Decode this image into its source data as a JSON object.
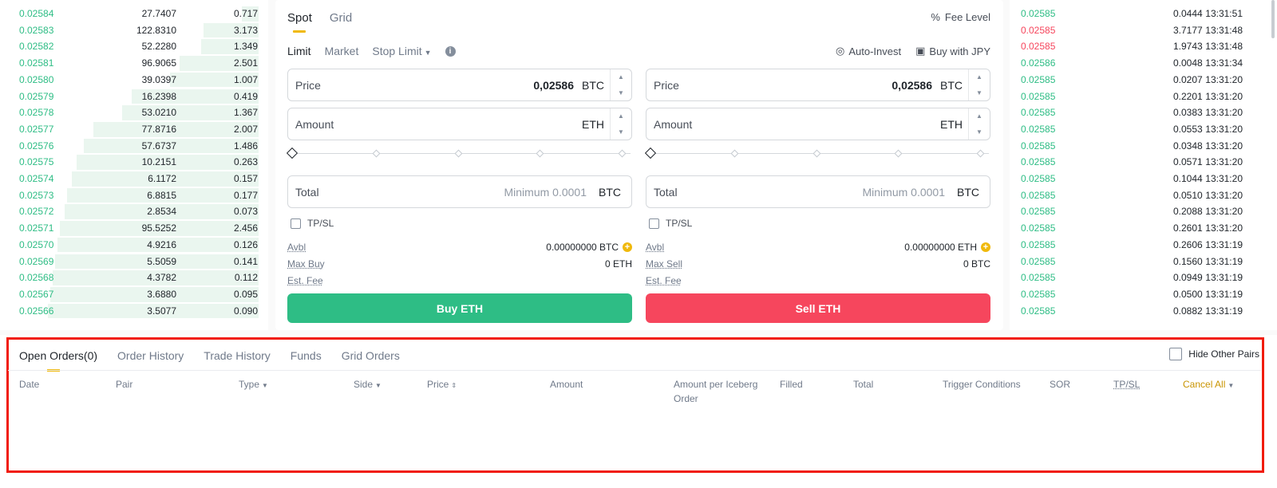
{
  "orderbook": {
    "rows": [
      {
        "price": "0.02584",
        "amount": "27.7407",
        "total": "0.717",
        "depth": 0.07
      },
      {
        "price": "0.02583",
        "amount": "122.8310",
        "total": "3.173",
        "depth": 0.23
      },
      {
        "price": "0.02582",
        "amount": "52.2280",
        "total": "1.349",
        "depth": 0.24
      },
      {
        "price": "0.02581",
        "amount": "96.9065",
        "total": "2.501",
        "depth": 0.33
      },
      {
        "price": "0.02580",
        "amount": "39.0397",
        "total": "1.007",
        "depth": 0.37
      },
      {
        "price": "0.02579",
        "amount": "16.2398",
        "total": "0.419",
        "depth": 0.53
      },
      {
        "price": "0.02578",
        "amount": "53.0210",
        "total": "1.367",
        "depth": 0.57
      },
      {
        "price": "0.02577",
        "amount": "77.8716",
        "total": "2.007",
        "depth": 0.69
      },
      {
        "price": "0.02576",
        "amount": "57.6737",
        "total": "1.486",
        "depth": 0.73
      },
      {
        "price": "0.02575",
        "amount": "10.2151",
        "total": "0.263",
        "depth": 0.76
      },
      {
        "price": "0.02574",
        "amount": "6.1172",
        "total": "0.157",
        "depth": 0.78
      },
      {
        "price": "0.02573",
        "amount": "6.8815",
        "total": "0.177",
        "depth": 0.8
      },
      {
        "price": "0.02572",
        "amount": "2.8534",
        "total": "0.073",
        "depth": 0.81
      },
      {
        "price": "0.02571",
        "amount": "95.5252",
        "total": "2.456",
        "depth": 0.83
      },
      {
        "price": "0.02570",
        "amount": "4.9216",
        "total": "0.126",
        "depth": 0.84
      },
      {
        "price": "0.02569",
        "amount": "5.5059",
        "total": "0.141",
        "depth": 0.85
      },
      {
        "price": "0.02568",
        "amount": "4.3782",
        "total": "0.112",
        "depth": 0.86
      },
      {
        "price": "0.02567",
        "amount": "3.6880",
        "total": "0.095",
        "depth": 0.87
      },
      {
        "price": "0.02566",
        "amount": "3.5077",
        "total": "0.090",
        "depth": 0.88
      }
    ]
  },
  "form": {
    "tabs": [
      "Spot",
      "Grid"
    ],
    "fee_level": "Fee Level",
    "order_types": [
      "Limit",
      "Market",
      "Stop Limit"
    ],
    "auto_invest": "Auto-Invest",
    "buy_with": "Buy with JPY",
    "buy": {
      "price_label": "Price",
      "price_value": "0,02586",
      "price_unit": "BTC",
      "amount_label": "Amount",
      "amount_unit": "ETH",
      "total_label": "Total",
      "total_placeholder": "Minimum 0.0001",
      "total_unit": "BTC",
      "tpsl": "TP/SL",
      "avbl_label": "Avbl",
      "avbl_value": "0.00000000 BTC",
      "max_label": "Max Buy",
      "max_value": "0 ETH",
      "fee_label": "Est. Fee",
      "button": "Buy ETH"
    },
    "sell": {
      "price_label": "Price",
      "price_value": "0,02586",
      "price_unit": "BTC",
      "amount_label": "Amount",
      "amount_unit": "ETH",
      "total_label": "Total",
      "total_placeholder": "Minimum 0.0001",
      "total_unit": "BTC",
      "tpsl": "TP/SL",
      "avbl_label": "Avbl",
      "avbl_value": "0.00000000 ETH",
      "max_label": "Max Sell",
      "max_value": "0 BTC",
      "fee_label": "Est. Fee",
      "button": "Sell ETH"
    }
  },
  "trades": {
    "rows": [
      {
        "price": "0.02585",
        "amount": "0.0444",
        "time": "13:31:51",
        "dir": "up"
      },
      {
        "price": "0.02585",
        "amount": "3.7177",
        "time": "13:31:48",
        "dir": "down"
      },
      {
        "price": "0.02585",
        "amount": "1.9743",
        "time": "13:31:48",
        "dir": "down"
      },
      {
        "price": "0.02586",
        "amount": "0.0048",
        "time": "13:31:34",
        "dir": "up"
      },
      {
        "price": "0.02585",
        "amount": "0.0207",
        "time": "13:31:20",
        "dir": "up"
      },
      {
        "price": "0.02585",
        "amount": "0.2201",
        "time": "13:31:20",
        "dir": "up"
      },
      {
        "price": "0.02585",
        "amount": "0.0383",
        "time": "13:31:20",
        "dir": "up"
      },
      {
        "price": "0.02585",
        "amount": "0.0553",
        "time": "13:31:20",
        "dir": "up"
      },
      {
        "price": "0.02585",
        "amount": "0.0348",
        "time": "13:31:20",
        "dir": "up"
      },
      {
        "price": "0.02585",
        "amount": "0.0571",
        "time": "13:31:20",
        "dir": "up"
      },
      {
        "price": "0.02585",
        "amount": "0.1044",
        "time": "13:31:20",
        "dir": "up"
      },
      {
        "price": "0.02585",
        "amount": "0.0510",
        "time": "13:31:20",
        "dir": "up"
      },
      {
        "price": "0.02585",
        "amount": "0.2088",
        "time": "13:31:20",
        "dir": "up"
      },
      {
        "price": "0.02585",
        "amount": "0.2601",
        "time": "13:31:20",
        "dir": "up"
      },
      {
        "price": "0.02585",
        "amount": "0.2606",
        "time": "13:31:19",
        "dir": "up"
      },
      {
        "price": "0.02585",
        "amount": "0.1560",
        "time": "13:31:19",
        "dir": "up"
      },
      {
        "price": "0.02585",
        "amount": "0.0949",
        "time": "13:31:19",
        "dir": "up"
      },
      {
        "price": "0.02585",
        "amount": "0.0500",
        "time": "13:31:19",
        "dir": "up"
      },
      {
        "price": "0.02585",
        "amount": "0.0882",
        "time": "13:31:19",
        "dir": "up"
      }
    ]
  },
  "orders": {
    "tabs": [
      "Open Orders(0)",
      "Order History",
      "Trade History",
      "Funds",
      "Grid Orders"
    ],
    "hide_other_pairs": "Hide Other Pairs",
    "columns": {
      "date": "Date",
      "pair": "Pair",
      "type": "Type",
      "side": "Side",
      "price": "Price",
      "amount": "Amount",
      "iceberg": "Amount per Iceberg Order",
      "filled": "Filled",
      "total": "Total",
      "trigger": "Trigger Conditions",
      "sor": "SOR",
      "tpsl": "TP/SL",
      "cancel_all": "Cancel All"
    }
  },
  "colors": {
    "buy": "#2ebd85",
    "sell": "#f6465d",
    "accent": "#f0b90b",
    "highlight": "#f11c0d"
  }
}
